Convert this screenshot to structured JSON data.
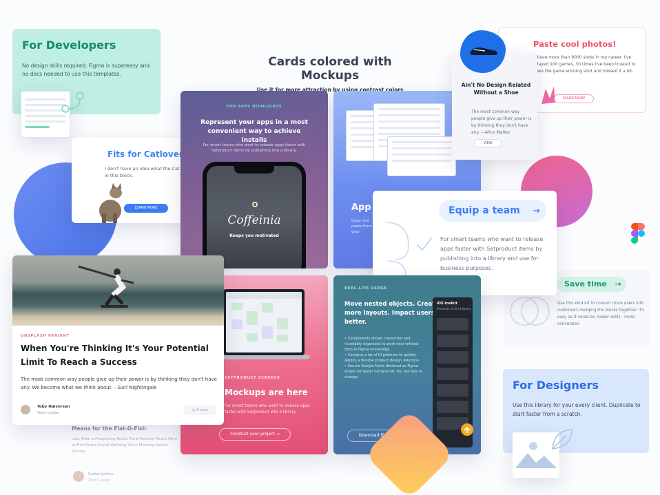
{
  "headline": {
    "title": "Cards colored with Mockups",
    "subtitle": "Use it for more attraction by using contrast colors"
  },
  "developers_card": {
    "title": "For Developers",
    "text": "No design skills required. Figma is supereasy and no docs needed to use this templates."
  },
  "cats_card": {
    "title": "Fits for Catlovers",
    "text": "I don't have an idea what the Cat is going on in this block.",
    "button": "LEARN MORE"
  },
  "apps_card": {
    "kicker": "FOR APPS HIGHLIGHTS",
    "title": "Represent your apps in a most convenient way to achieve installs",
    "text": "For smart teams who want to release apps faster with Setproduct items by publishing into a library.",
    "app_name": "Coffeinia",
    "app_tagline": "Keeps you motivated"
  },
  "forms_card": {
    "title": "App",
    "text": "Copy and paste from your"
  },
  "equip_card": {
    "pill": "Equip a team",
    "arrow": "→",
    "text": "For smart teams who want to release apps faster with Setproduct items by publishing into a library and use for business purposes."
  },
  "photos_card": {
    "title": "Paste cool photos!",
    "text": "I have more than 9000 shots in my career. I've played 100 games, 30 times I've been trusted to take the game winning shot and missed it a lot.",
    "button": "LEARN MORE"
  },
  "shoe_card": {
    "title": "Ain't No Design Related Without a Shoe",
    "text": "The most common way people give up their power is by thinking they don't have any. —Alice Walker",
    "button": "VIEW"
  },
  "save_card": {
    "pill": "Save time",
    "arrow": "→",
    "text": "Use this kind kit to convert more users into customers merging the blocks together. It's easy as it could be. Fewer skills - more conversion."
  },
  "designers_card": {
    "title": "For Designers",
    "text": "Use this library for your every client. Duplicate to start faster from a scratch."
  },
  "beach_card": {
    "kicker": "UNSPLASH VARIANT",
    "title": "When You're Thinking It's Your Potential Limit To Reach a Success",
    "text": "The most common way people give up their power is by thinking they don't have any. We become what we think about. – Earl Nightingale",
    "author": "Toby Halvorsen",
    "role": "Team Leader",
    "read_time": "4 mins"
  },
  "ghost_card": {
    "title": "Means for the Flat-O-Fish",
    "text": "Lam Allen a Prospering Rustic Rural Ancient Peace Here at Fish Farms Found Working, Even Morning Sellers Scenes",
    "author": "Parker Jonkes",
    "role": "Team Leader"
  },
  "mockups_card": {
    "kicker": "SETPRODUCT SCREENS",
    "title": "Mockups are here",
    "text": "For smart teams who want to release apps faster with Setproduct into a library",
    "button": "Constuct your project →"
  },
  "teal_card": {
    "kicker": "REAL-LIFE USAGE",
    "title": "Move nested objects. Create more layouts. Impact users better.",
    "text": "• Components shows connected and incredibly organized to work best without docs in Figma knowledge.\n• Contains a lot of UI patterns to quickly deploy a flexible product design solutions.\n• Source Google Fonts declared as Figma shows for faster turnaround. You are free to change.",
    "button": "Download file",
    "ui_title": "iOS toolkit",
    "ui_sub": "Elements of UI kit library"
  },
  "colors": {
    "dev_green": "#168a66",
    "blue_accent": "#3a7df0",
    "pink_accent": "#ef5468",
    "purple_card": "#7e5f95",
    "teal_card": "#45809c",
    "pink_card": "#ec6d8e"
  }
}
